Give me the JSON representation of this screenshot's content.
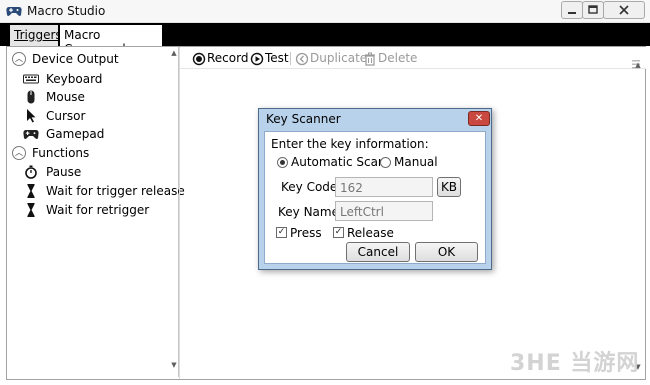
{
  "window": {
    "title": "Macro Studio",
    "app_icon": "gamepad-icon"
  },
  "tabs": [
    {
      "label": "Triggers",
      "selected": false
    },
    {
      "label": "Macro Commands",
      "selected": true
    }
  ],
  "sidebar": {
    "groups": [
      {
        "label": "Device Output",
        "items": [
          {
            "label": "Keyboard",
            "icon": "keyboard-icon"
          },
          {
            "label": "Mouse",
            "icon": "mouse-icon"
          },
          {
            "label": "Cursor",
            "icon": "cursor-icon"
          },
          {
            "label": "Gamepad",
            "icon": "gamepad-icon"
          }
        ]
      },
      {
        "label": "Functions",
        "items": [
          {
            "label": "Pause",
            "icon": "stopwatch-icon"
          },
          {
            "label": "Wait for trigger release",
            "icon": "hourglass-icon"
          },
          {
            "label": "Wait for retrigger",
            "icon": "hourglass-icon"
          }
        ]
      }
    ]
  },
  "toolbar": {
    "record": "Record",
    "test": "Test",
    "duplicate": "Duplicate",
    "delete": "Delete"
  },
  "dialog": {
    "title": "Key Scanner",
    "prompt": "Enter the key information:",
    "mode_automatic": "Automatic Scan",
    "mode_manual": "Manual",
    "selected_mode": "Automatic Scan",
    "key_code_label": "Key Code:",
    "key_code_value": "162",
    "kb_button": "KB",
    "key_name_label": "Key Name:",
    "key_name_value": "LeftCtrl",
    "press_label": "Press",
    "press_checked": true,
    "release_label": "Release",
    "release_checked": true,
    "cancel": "Cancel",
    "ok": "OK"
  },
  "watermark": "3HE 当游网",
  "colors": {
    "tabbar_bg": "#000000",
    "dialog_frame": "#b8d2eb",
    "close_red": "#c9483f"
  }
}
